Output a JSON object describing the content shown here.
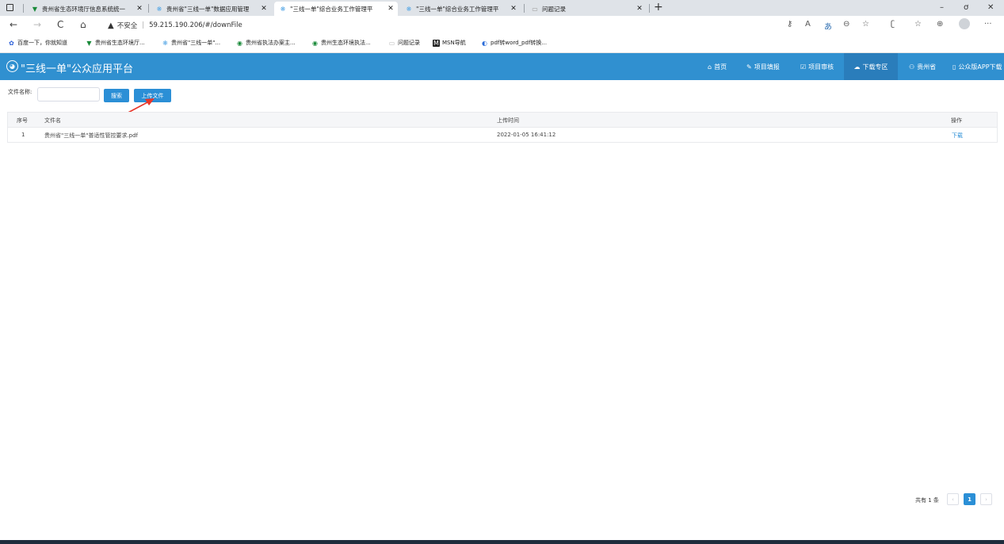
{
  "browser": {
    "tabs": [
      {
        "title": "贵州省生态环境厅信息系统统一",
        "icon": "v-logo-icon"
      },
      {
        "title": "贵州省\"三线一单\"数据应用管理",
        "icon": "blue-flower-icon"
      },
      {
        "title": "\"三线一单\"综合业务工作管理平",
        "icon": "blue-flower-icon"
      },
      {
        "title": "\"三线一单\"综合业务工作管理平",
        "icon": "blue-flower-icon"
      },
      {
        "title": "问题记录",
        "icon": "page-icon"
      }
    ],
    "new_tab": "+",
    "window": {
      "minimize": "–",
      "restore": "ơ",
      "close": "✕"
    },
    "nav": {
      "back": "←",
      "forward": "→",
      "reload": "C",
      "home": "⌂"
    },
    "address": {
      "security": "不安全",
      "url": "59.215.190.206/#/downFile"
    },
    "toolbar_icons": [
      "key-icon",
      "read-aloud-icon",
      "translate-icon",
      "zoom-icon",
      "favorite-add-icon",
      "extensions-icon",
      "favorites-icon",
      "collections-icon",
      "profile-icon",
      "more-icon"
    ],
    "bookmarks": [
      {
        "label": "百度一下，你就知道",
        "icon": "baidu-icon"
      },
      {
        "label": "贵州省生态环境厅...",
        "icon": "v-logo-icon"
      },
      {
        "label": "贵州省\"三线一单\"...",
        "icon": "blue-flower-icon"
      },
      {
        "label": "贵州省执法办案主...",
        "icon": "green-dot-icon"
      },
      {
        "label": "贵州生态环境执法...",
        "icon": "green-dot-icon"
      },
      {
        "label": "问题记录",
        "icon": "page-icon"
      },
      {
        "label": "MSN导航",
        "icon": "msn-icon"
      },
      {
        "label": "pdf转word_pdf转换...",
        "icon": "pdf-convert-icon"
      }
    ]
  },
  "app": {
    "title": "\"三线一单\"公众应用平台",
    "menu": [
      {
        "label": "首页",
        "icon": "home-icon"
      },
      {
        "label": "项目填报",
        "icon": "edit-icon"
      },
      {
        "label": "项目审核",
        "icon": "check-icon"
      },
      {
        "label": "下载专区",
        "icon": "cloud-download-icon",
        "active": true
      },
      {
        "label": "贵州省",
        "icon": "user-icon"
      },
      {
        "label": "公众版APP下载",
        "icon": "phone-icon"
      }
    ]
  },
  "search": {
    "label": "文件名称:",
    "value": "",
    "search_button": "搜索",
    "upload_button": "上传文件"
  },
  "table": {
    "headers": [
      "序号",
      "文件名",
      "上传时间",
      "操作"
    ],
    "rows": [
      {
        "index": "1",
        "filename": "贵州省\"三线一单\"普适性管控要求.pdf",
        "time": "2022-01-05 16:41:12",
        "action": "下载"
      }
    ]
  },
  "pagination": {
    "total_text": "共有 1 条",
    "prev": "‹",
    "current": "1",
    "next": "›"
  },
  "colors": {
    "header_bg": "#3090d0",
    "active_menu_bg": "#2a7dbb",
    "primary": "#2b8fd6",
    "arrow": "#e8362a"
  }
}
